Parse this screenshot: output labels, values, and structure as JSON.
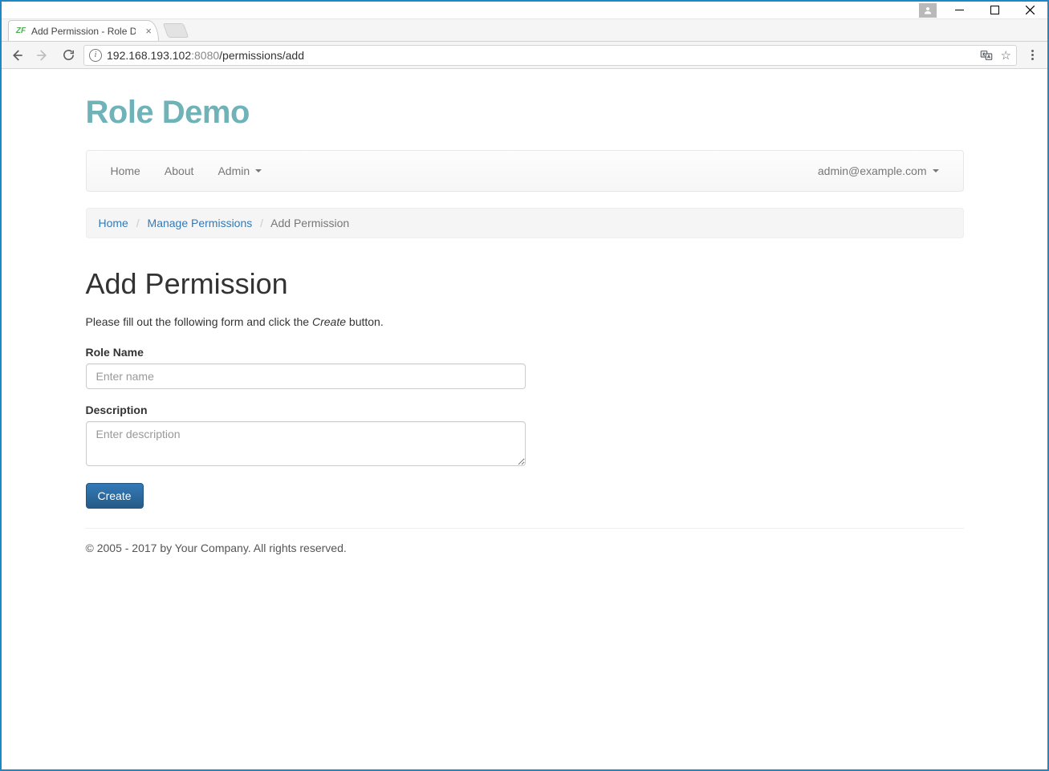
{
  "browser": {
    "tab_title": "Add Permission - Role De",
    "url_host": "192.168.193.102",
    "url_port": ":8080",
    "url_path": "/permissions/add"
  },
  "brand": "Role Demo",
  "nav": {
    "home": "Home",
    "about": "About",
    "admin": "Admin",
    "user": "admin@example.com"
  },
  "breadcrumb": {
    "home": "Home",
    "manage": "Manage Permissions",
    "current": "Add Permission"
  },
  "page": {
    "title": "Add Permission",
    "lead_pre": "Please fill out the following form and click the ",
    "lead_em": "Create",
    "lead_post": " button."
  },
  "form": {
    "name_label": "Role Name",
    "name_placeholder": "Enter name",
    "name_value": "",
    "desc_label": "Description",
    "desc_placeholder": "Enter description",
    "desc_value": "",
    "submit": "Create"
  },
  "footer": "© 2005 - 2017 by Your Company. All rights reserved."
}
